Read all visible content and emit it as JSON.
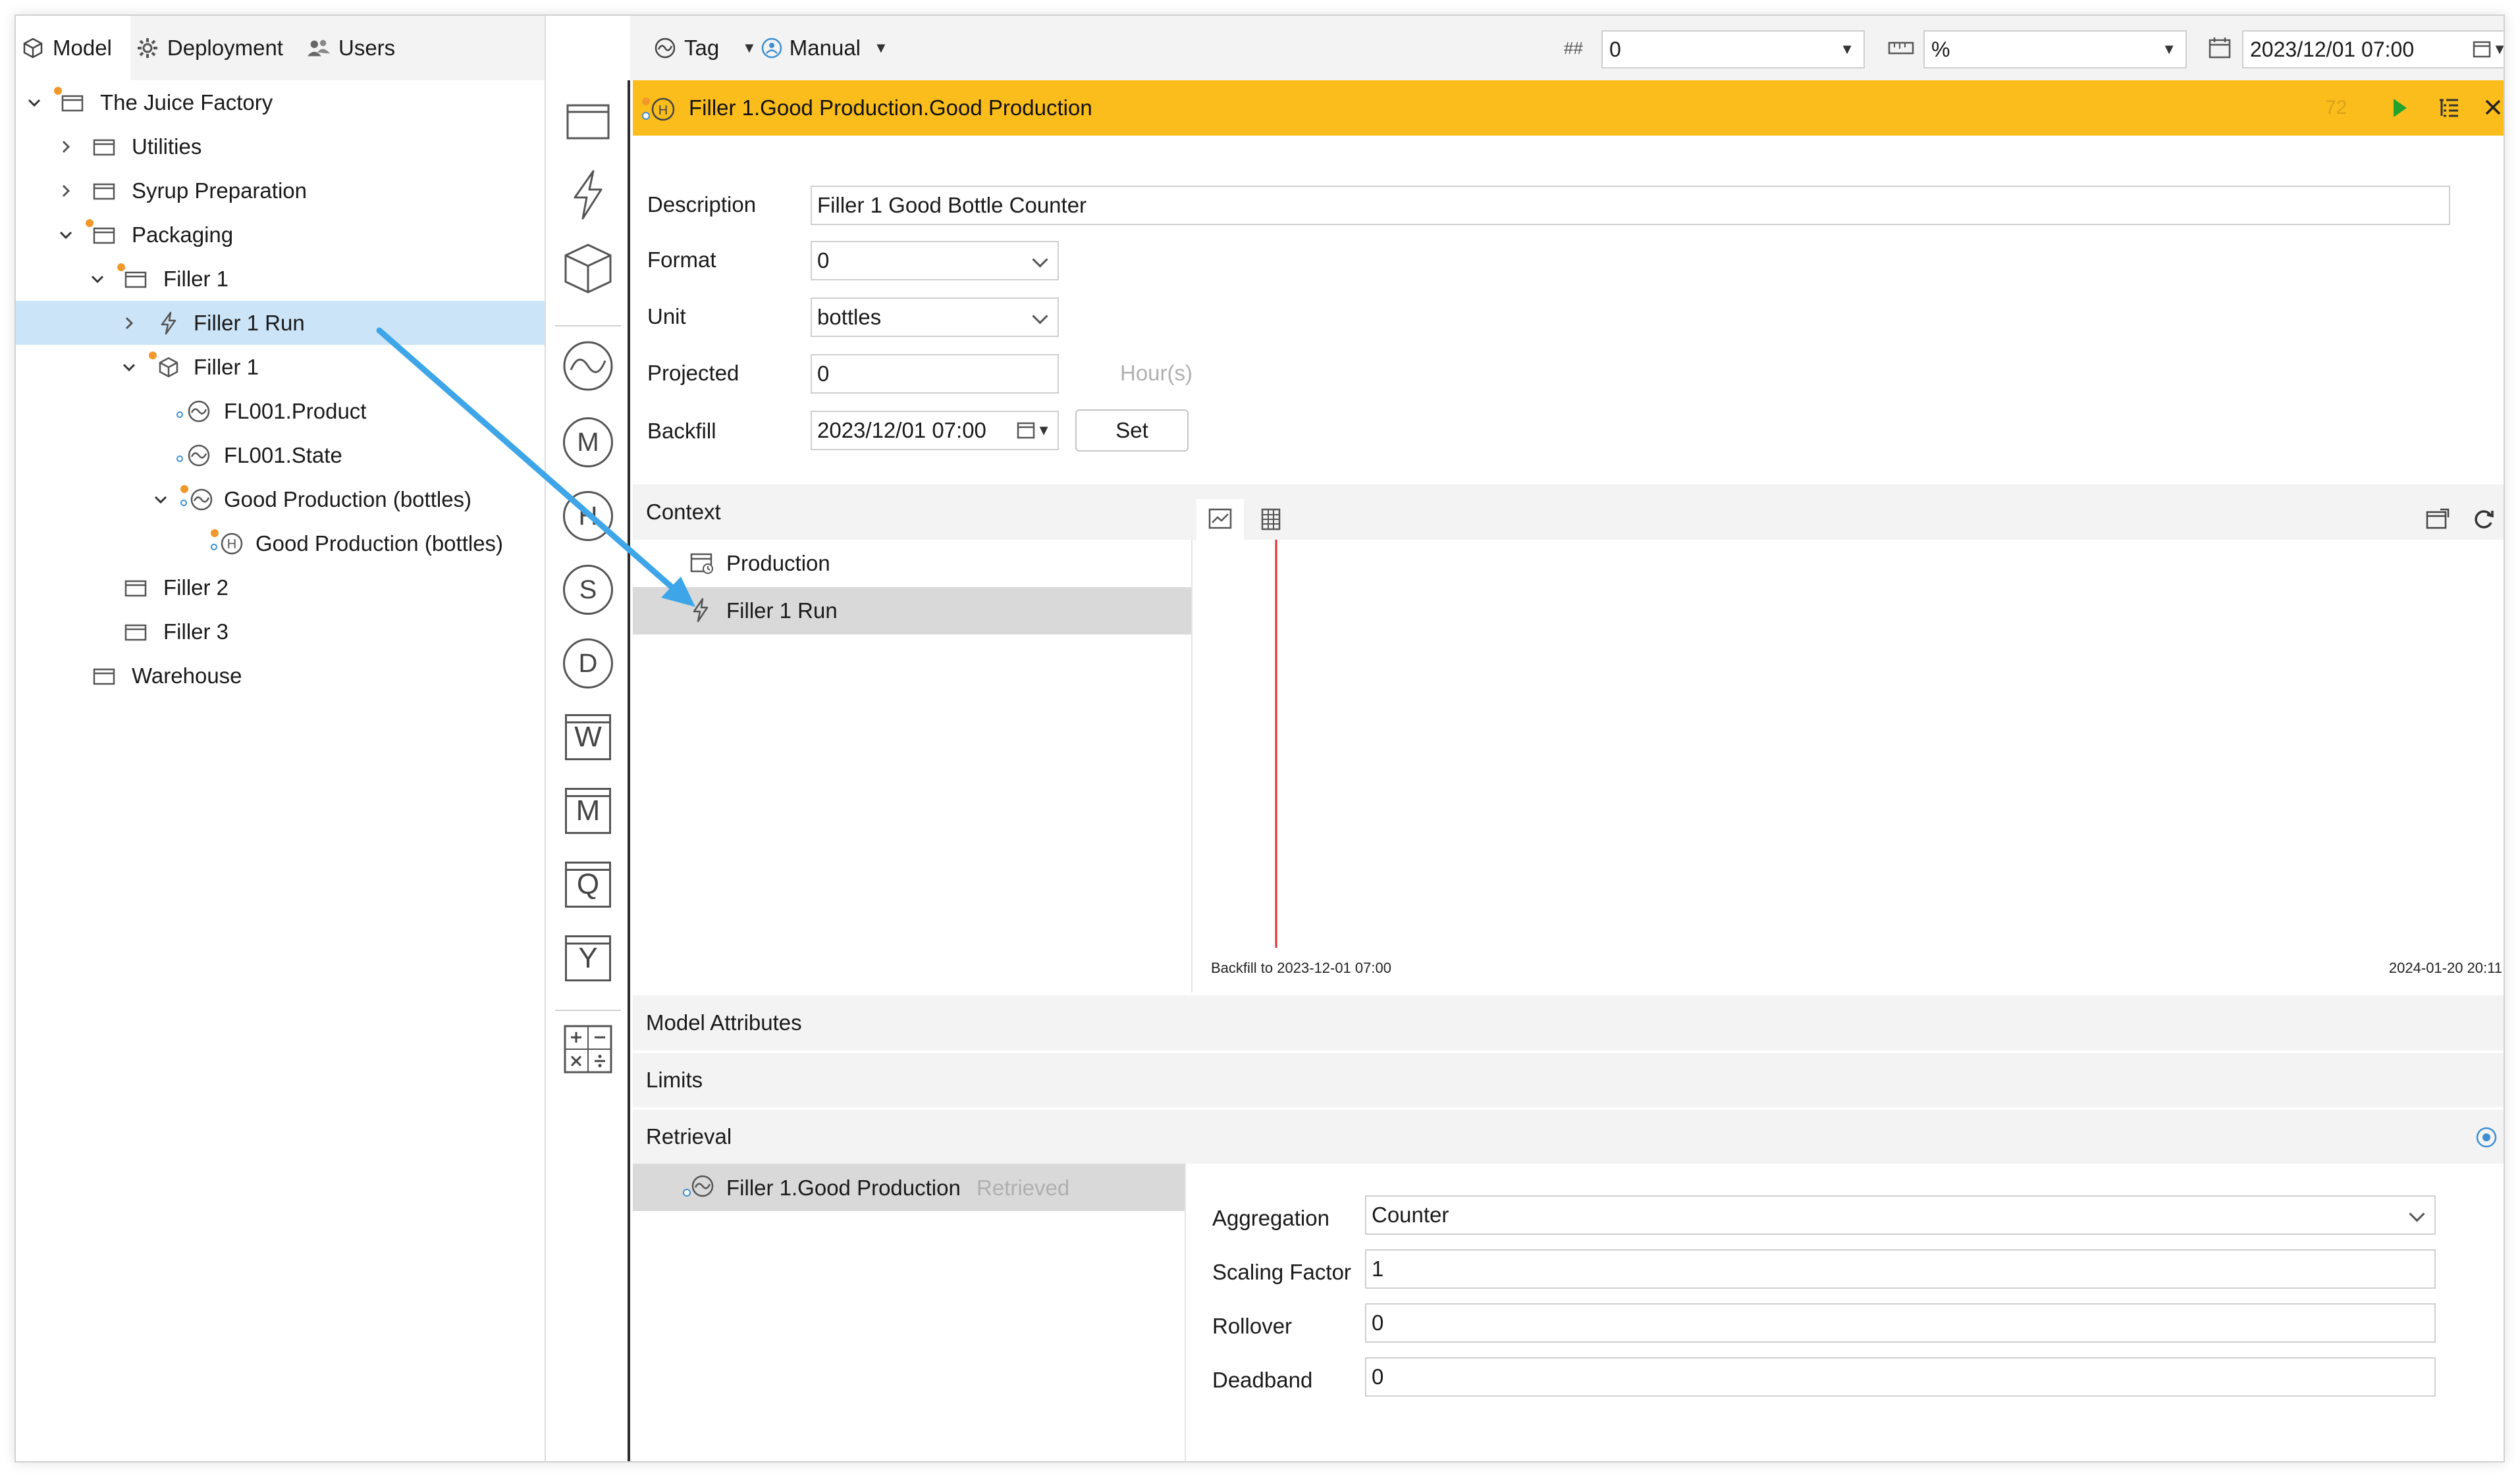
{
  "left_tabs": [
    {
      "label": "Model",
      "icon": "cube-icon"
    },
    {
      "label": "Deployment",
      "icon": "gear-icon"
    },
    {
      "label": "Users",
      "icon": "users-icon"
    }
  ],
  "tree": {
    "root": "The Juice Factory",
    "utilities": "Utilities",
    "syrup": "Syrup Preparation",
    "packaging": "Packaging",
    "filler1": "Filler 1",
    "filler1_run": "Filler 1 Run",
    "filler1_asset": "Filler 1",
    "product": "FL001.Product",
    "state": "FL001.State",
    "good_prod": "Good Production (bottles)",
    "good_prod_h": "Good Production (bottles)",
    "filler2": "Filler 2",
    "filler3": "Filler 3",
    "warehouse": "Warehouse"
  },
  "toolbar": {
    "tag_label": "Tag",
    "manual_label": "Manual",
    "format_symbol": "##",
    "format_value": "0",
    "unit_value": "%",
    "date_value": "2023/12/01 07:00"
  },
  "title": {
    "text": "Filler 1.Good Production.Good Production",
    "count": "72",
    "color": "#fbbd1b"
  },
  "form": {
    "description_label": "Description",
    "description_value": "Filler 1 Good Bottle Counter",
    "format_label": "Format",
    "format_value": "0",
    "unit_label": "Unit",
    "unit_value": "bottles",
    "projected_label": "Projected",
    "projected_value": "0",
    "projected_unit": "Hour(s)",
    "backfill_label": "Backfill",
    "backfill_value": "2023/12/01 07:00",
    "set_label": "Set"
  },
  "context": {
    "header": "Context",
    "items": [
      "Production",
      "Filler 1 Run"
    ],
    "chart_start_label": "Backfill to 2023-12-01 07:00",
    "chart_end_label": "2024-01-20 20:11"
  },
  "sections": {
    "model_attributes": "Model Attributes",
    "limits": "Limits",
    "retrieval": "Retrieval"
  },
  "retrieval": {
    "item_label": "Filler 1.Good Production",
    "item_status": "Retrieved",
    "aggregation_label": "Aggregation",
    "aggregation_value": "Counter",
    "scaling_label": "Scaling Factor",
    "scaling_value": "1",
    "rollover_label": "Rollover",
    "rollover_value": "0",
    "deadband_label": "Deadband",
    "deadband_value": "0"
  },
  "tools": [
    {
      "icon": "folder-icon"
    },
    {
      "icon": "lightning-icon"
    },
    {
      "icon": "cube-icon"
    },
    {
      "icon": "trend-icon"
    },
    {
      "icon": "m-circle-icon",
      "text": "M"
    },
    {
      "icon": "h-circle-icon",
      "text": "H"
    },
    {
      "icon": "s-circle-icon",
      "text": "S"
    },
    {
      "icon": "d-circle-icon",
      "text": "D"
    },
    {
      "icon": "w-square-icon",
      "text": "W"
    },
    {
      "icon": "m-square-icon",
      "text": "M"
    },
    {
      "icon": "q-square-icon",
      "text": "Q"
    },
    {
      "icon": "y-square-icon",
      "text": "Y"
    },
    {
      "icon": "calculator-icon"
    }
  ],
  "colors": {
    "accent": "#fbbd1b",
    "selection": "#cce4f7",
    "arrow": "#3ea6e8",
    "marker": "#e03030",
    "orange_dot": "#f2982a"
  }
}
